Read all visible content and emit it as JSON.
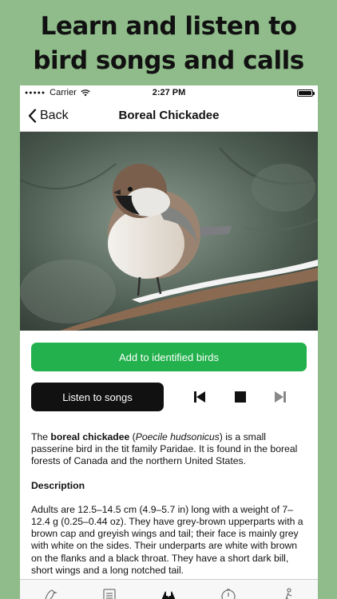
{
  "promo": {
    "line1": "Learn and listen to",
    "line2": "bird songs and calls"
  },
  "status": {
    "carrier": "Carrier",
    "time": "2:27 PM"
  },
  "nav": {
    "back_label": "Back",
    "title": "Boreal Chickadee"
  },
  "actions": {
    "add_label": "Add to identified birds",
    "listen_label": "Listen to songs"
  },
  "player": {
    "prev_icon": "skip-back-icon",
    "stop_icon": "stop-icon",
    "next_icon": "skip-forward-icon"
  },
  "article": {
    "intro_pre": "The ",
    "intro_name": "boreal chickadee",
    "intro_mid": " (",
    "intro_latin": "Poecile hudsonicus",
    "intro_post": ") is a small passerine bird in the tit family Paridae. It is found in the boreal forests of Canada and the northern United States.",
    "description_heading": "Description",
    "description_text": "Adults are 12.5–14.5 cm (4.9–5.7 in) long with a weight of 7–12.4 g (0.25–0.44 oz). They have grey-brown upperparts with a brown cap and greyish wings and tail; their face is mainly grey with white on the sides. Their underparts are white with brown on the flanks and a black throat. They have a short dark bill, short wings and a long notched tail."
  },
  "colors": {
    "background": "#8fbc8a",
    "accent_green": "#22b14c",
    "button_black": "#111111"
  },
  "tabs": [
    "bird-icon",
    "list-icon",
    "identify-icon",
    "timer-icon",
    "walk-icon"
  ]
}
